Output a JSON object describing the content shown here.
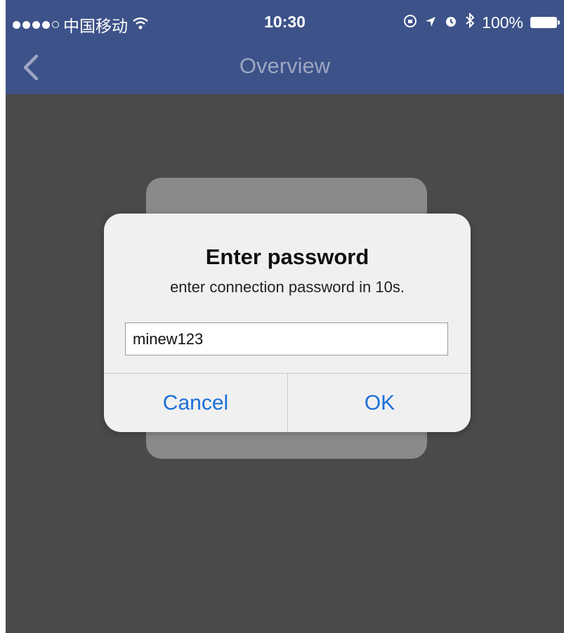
{
  "status_bar": {
    "carrier": "中国移动",
    "time": "10:30",
    "battery": "100%",
    "icons": [
      "signal-dots-icon",
      "wifi-icon",
      "lock-rotation-icon",
      "location-icon",
      "alarm-icon",
      "bluetooth-icon",
      "battery-icon"
    ]
  },
  "navbar": {
    "title": "Overview",
    "back_icon": "chevron-left-icon"
  },
  "dialog": {
    "title": "Enter password",
    "message": "enter connection password in 10s.",
    "input_value": "minew123",
    "cancel_label": "Cancel",
    "ok_label": "OK"
  },
  "colors": {
    "navbar_bg": "#3d5289",
    "nav_title": "#9da6c2",
    "overlay_bg": "#4a4a4a",
    "button_text": "#1a6fd8"
  }
}
